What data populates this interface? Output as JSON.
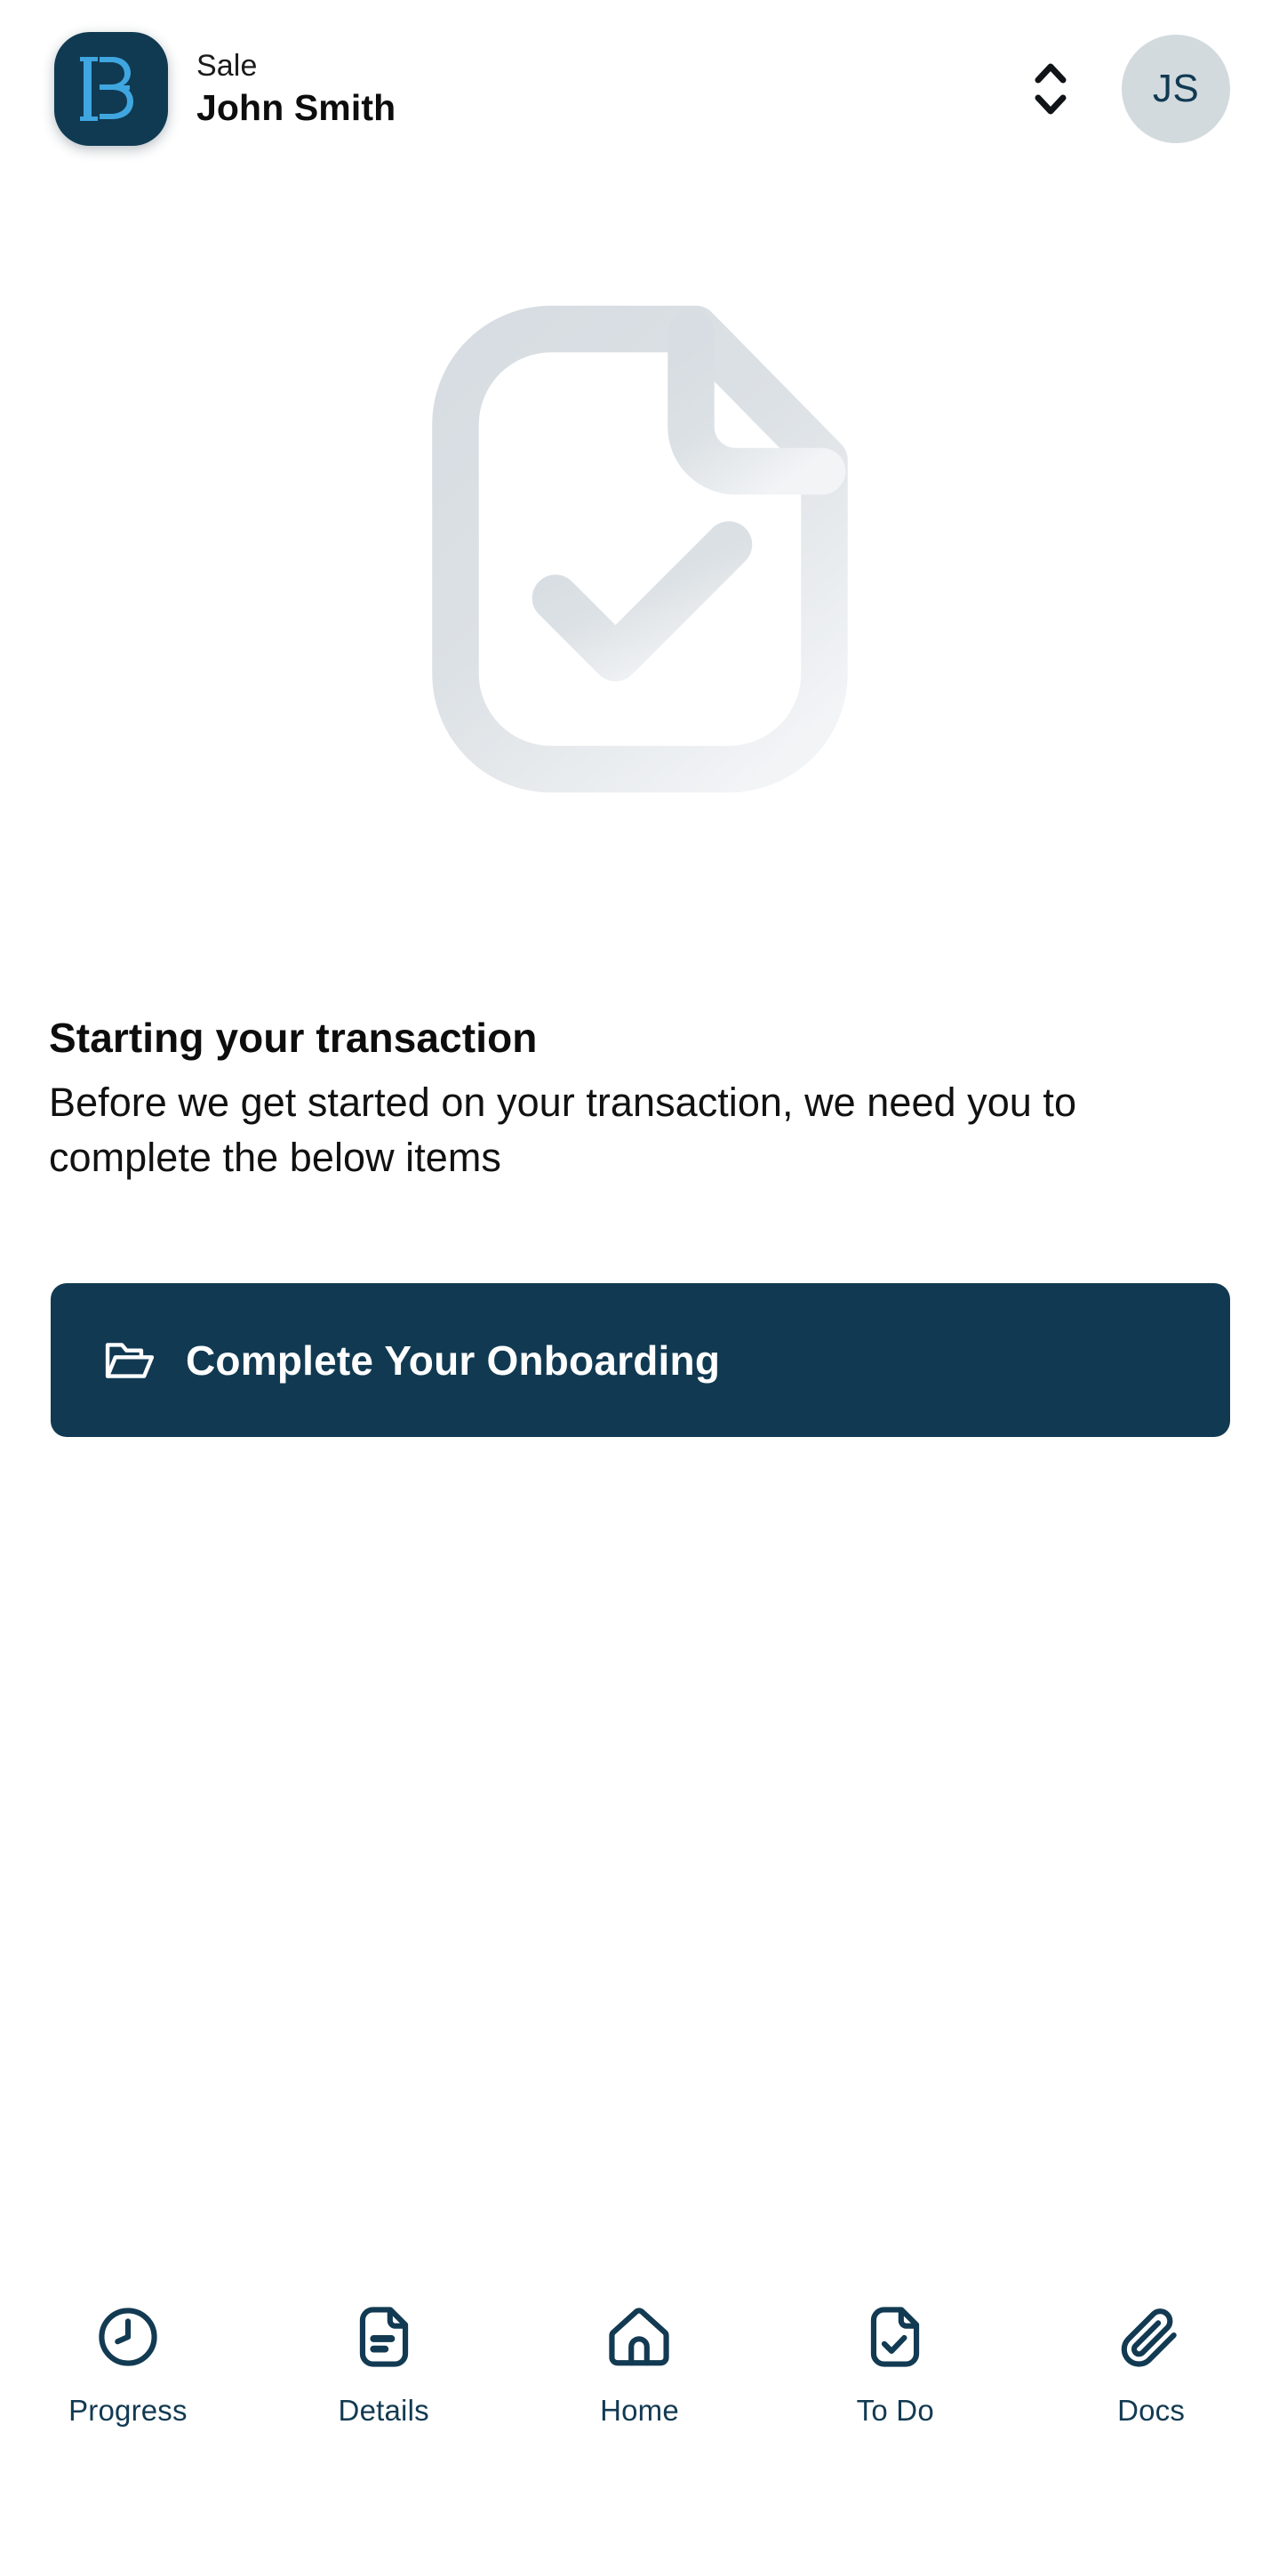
{
  "header": {
    "logo_alt": "brand-monogram-b",
    "subtitle": "Sale",
    "title": "John Smith",
    "selector_icon": "chevron-up-down-icon",
    "avatar_initials": "JS",
    "colors": {
      "logo_background": "#103A52",
      "logo_mark": "#3FA6E0",
      "avatar_background": "#D2DADE",
      "avatar_text": "#103A52"
    }
  },
  "hero": {
    "illustration": "document-check-icon",
    "color": "#DCE1E5"
  },
  "content": {
    "heading": "Starting your transaction",
    "body": "Before we get started on your transaction, we need you to complete the below items"
  },
  "cta": {
    "icon": "open-folder-icon",
    "label": "Complete Your Onboarding",
    "background": "#113A52",
    "text_color": "#FFFFFF"
  },
  "bottom_nav": {
    "color": "#123A52",
    "items": [
      {
        "label": "Progress",
        "icon": "clock-icon"
      },
      {
        "label": "Details",
        "icon": "document-lines-icon"
      },
      {
        "label": "Home",
        "icon": "home-icon"
      },
      {
        "label": "To Do",
        "icon": "document-check-icon"
      },
      {
        "label": "Docs",
        "icon": "paperclip-icon"
      }
    ]
  }
}
